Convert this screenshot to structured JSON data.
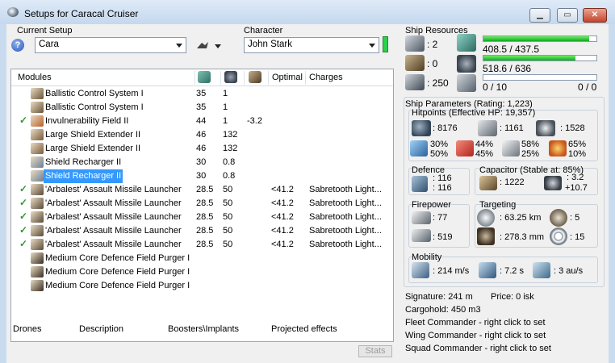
{
  "window": {
    "title": "Setups for Caracal Cruiser",
    "buttons": {
      "minimize": "▁",
      "maximize": "▭",
      "close": "✕"
    }
  },
  "setup": {
    "group_label": "Current Setup",
    "value": "Cara",
    "character_label": "Character",
    "character_value": "John Stark"
  },
  "modules": {
    "header": {
      "name": "Modules",
      "optimal": "Optimal",
      "charges": "Charges"
    },
    "rows": [
      {
        "checked": "",
        "name": "Ballistic Control System I",
        "cpu": "35",
        "power": "1",
        "cap": "",
        "optimal": "",
        "charges": "",
        "icon": "ballistic-control-icon",
        "color": "#6b5436"
      },
      {
        "checked": "",
        "name": "Ballistic Control System I",
        "cpu": "35",
        "power": "1",
        "cap": "",
        "optimal": "",
        "charges": "",
        "icon": "ballistic-control-icon",
        "color": "#6b5436"
      },
      {
        "checked": "✓",
        "name": "Invulnerability Field II",
        "cpu": "44",
        "power": "1",
        "cap": "-3.2",
        "optimal": "",
        "charges": "",
        "icon": "invulnerability-field-icon",
        "color": "#b9622a"
      },
      {
        "checked": "",
        "name": "Large Shield Extender II",
        "cpu": "46",
        "power": "132",
        "cap": "",
        "optimal": "",
        "charges": "",
        "icon": "shield-extender-icon",
        "color": "#7a5a3a"
      },
      {
        "checked": "",
        "name": "Large Shield Extender II",
        "cpu": "46",
        "power": "132",
        "cap": "",
        "optimal": "",
        "charges": "",
        "icon": "shield-extender-icon",
        "color": "#7a5a3a"
      },
      {
        "checked": "",
        "name": "Shield Recharger II",
        "cpu": "30",
        "power": "0.8",
        "cap": "",
        "optimal": "",
        "charges": "",
        "icon": "shield-recharger-icon",
        "color": "#6d7f93"
      },
      {
        "checked": "",
        "name": "Shield Recharger II",
        "cpu": "30",
        "power": "0.8",
        "cap": "",
        "optimal": "",
        "charges": "",
        "icon": "shield-recharger-icon",
        "color": "#6d7f93",
        "selected": true
      },
      {
        "checked": "✓",
        "name": "'Arbalest' Assault Missile Launcher",
        "cpu": "28.5",
        "power": "50",
        "cap": "",
        "optimal": "<41.2",
        "charges": "Sabretooth Light...",
        "icon": "missile-launcher-icon",
        "color": "#5a4a36"
      },
      {
        "checked": "✓",
        "name": "'Arbalest' Assault Missile Launcher",
        "cpu": "28.5",
        "power": "50",
        "cap": "",
        "optimal": "<41.2",
        "charges": "Sabretooth Light...",
        "icon": "missile-launcher-icon",
        "color": "#5a4a36"
      },
      {
        "checked": "✓",
        "name": "'Arbalest' Assault Missile Launcher",
        "cpu": "28.5",
        "power": "50",
        "cap": "",
        "optimal": "<41.2",
        "charges": "Sabretooth Light...",
        "icon": "missile-launcher-icon",
        "color": "#5a4a36"
      },
      {
        "checked": "✓",
        "name": "'Arbalest' Assault Missile Launcher",
        "cpu": "28.5",
        "power": "50",
        "cap": "",
        "optimal": "<41.2",
        "charges": "Sabretooth Light...",
        "icon": "missile-launcher-icon",
        "color": "#5a4a36"
      },
      {
        "checked": "✓",
        "name": "'Arbalest' Assault Missile Launcher",
        "cpu": "28.5",
        "power": "50",
        "cap": "",
        "optimal": "<41.2",
        "charges": "Sabretooth Light...",
        "icon": "missile-launcher-icon",
        "color": "#5a4a36"
      },
      {
        "checked": "",
        "name": "Medium Core Defence Field Purger I",
        "cpu": "",
        "power": "",
        "cap": "",
        "optimal": "",
        "charges": "",
        "icon": "field-purger-icon",
        "color": "#3a2d22"
      },
      {
        "checked": "",
        "name": "Medium Core Defence Field Purger I",
        "cpu": "",
        "power": "",
        "cap": "",
        "optimal": "",
        "charges": "",
        "icon": "field-purger-icon",
        "color": "#3a2d22"
      },
      {
        "checked": "",
        "name": "Medium Core Defence Field Purger I",
        "cpu": "",
        "power": "",
        "cap": "",
        "optimal": "",
        "charges": "",
        "icon": "field-purger-icon",
        "color": "#3a2d22"
      }
    ]
  },
  "tabs": {
    "drones": "Drones",
    "description": "Description",
    "boosters": "Boosters\\Implants",
    "projected": "Projected effects",
    "stats": "Stats"
  },
  "resources": {
    "title": "Ship Resources",
    "turret_slots": ": 2",
    "launcher_slots": ": 0",
    "drone_bay": ": 250",
    "cpu": {
      "text": "408.5 / 437.5",
      "fraction": 0.934
    },
    "powergrid": {
      "text": "518.6 / 636",
      "fraction": 0.815
    },
    "calibration": {
      "text": "0 / 10",
      "fraction": 0
    },
    "drones_text": "0 / 0"
  },
  "params": {
    "title": "Ship Parameters (Rating: 1,223)",
    "hitpoints": {
      "title": "Hitpoints (Effective HP: 19,357)",
      "shield": ": 8176",
      "armor": ": 1161",
      "structure": ": 1528",
      "em": [
        "30%",
        "50%"
      ],
      "thermal": [
        "44%",
        "45%"
      ],
      "kinetic": [
        "58%",
        "25%"
      ],
      "explosive": [
        "65%",
        "10%"
      ]
    },
    "defence": {
      "title": "Defence",
      "a": ": 116",
      "b": ": 116"
    },
    "capacitor": {
      "title": "Capacitor (Stable at: 85%)",
      "capacity": ": 1222",
      "delta_a": ": 3.2",
      "delta_b": "+10.7"
    },
    "firepower": {
      "title": "Firepower",
      "volley": ": 77",
      "dps": ": 519"
    },
    "targeting": {
      "title": "Targeting",
      "range": ": 63.25 km",
      "max_targets": ": 5",
      "scan_res": ": 278.3 mm",
      "sensor": ": 15"
    },
    "mobility": {
      "title": "Mobility",
      "speed": ": 214 m/s",
      "align": ": 7.2 s",
      "warp": ": 3 au/s"
    }
  },
  "footer": {
    "signature": "Signature: 241 m",
    "price": "Price: 0 isk",
    "cargohold": "Cargohold: 450 m3",
    "fleet": "Fleet Commander - right click to set",
    "wing": "Wing Commander - right click to set",
    "squad": "Squad Commander - right click to set"
  }
}
